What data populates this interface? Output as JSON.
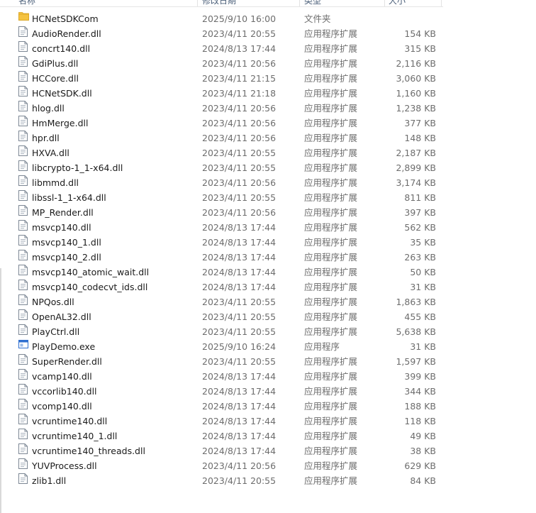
{
  "header": {
    "name": "名称",
    "date": "修改日期",
    "type": "类型",
    "size": "大小"
  },
  "files": [
    {
      "name": "HCNetSDKCom",
      "date": "2025/9/10 16:00",
      "type": "文件夹",
      "size": "",
      "icon": "folder-icon"
    },
    {
      "name": "AudioRender.dll",
      "date": "2023/4/11 20:55",
      "type": "应用程序扩展",
      "size": "154 KB",
      "icon": "dll-file-icon"
    },
    {
      "name": "concrt140.dll",
      "date": "2024/8/13 17:44",
      "type": "应用程序扩展",
      "size": "315 KB",
      "icon": "dll-file-icon"
    },
    {
      "name": "GdiPlus.dll",
      "date": "2023/4/11 20:56",
      "type": "应用程序扩展",
      "size": "2,116 KB",
      "icon": "dll-file-icon"
    },
    {
      "name": "HCCore.dll",
      "date": "2023/4/11 21:15",
      "type": "应用程序扩展",
      "size": "3,060 KB",
      "icon": "dll-file-icon"
    },
    {
      "name": "HCNetSDK.dll",
      "date": "2023/4/11 21:18",
      "type": "应用程序扩展",
      "size": "1,160 KB",
      "icon": "dll-file-icon"
    },
    {
      "name": "hlog.dll",
      "date": "2023/4/11 20:56",
      "type": "应用程序扩展",
      "size": "1,238 KB",
      "icon": "dll-file-icon"
    },
    {
      "name": "HmMerge.dll",
      "date": "2023/4/11 20:56",
      "type": "应用程序扩展",
      "size": "377 KB",
      "icon": "dll-file-icon"
    },
    {
      "name": "hpr.dll",
      "date": "2023/4/11 20:56",
      "type": "应用程序扩展",
      "size": "148 KB",
      "icon": "dll-file-icon"
    },
    {
      "name": "HXVA.dll",
      "date": "2023/4/11 20:55",
      "type": "应用程序扩展",
      "size": "2,187 KB",
      "icon": "dll-file-icon"
    },
    {
      "name": "libcrypto-1_1-x64.dll",
      "date": "2023/4/11 20:55",
      "type": "应用程序扩展",
      "size": "2,899 KB",
      "icon": "dll-file-icon"
    },
    {
      "name": "libmmd.dll",
      "date": "2023/4/11 20:56",
      "type": "应用程序扩展",
      "size": "3,174 KB",
      "icon": "dll-file-icon"
    },
    {
      "name": "libssl-1_1-x64.dll",
      "date": "2023/4/11 20:55",
      "type": "应用程序扩展",
      "size": "811 KB",
      "icon": "dll-file-icon"
    },
    {
      "name": "MP_Render.dll",
      "date": "2023/4/11 20:56",
      "type": "应用程序扩展",
      "size": "397 KB",
      "icon": "dll-file-icon"
    },
    {
      "name": "msvcp140.dll",
      "date": "2024/8/13 17:44",
      "type": "应用程序扩展",
      "size": "562 KB",
      "icon": "dll-file-icon"
    },
    {
      "name": "msvcp140_1.dll",
      "date": "2024/8/13 17:44",
      "type": "应用程序扩展",
      "size": "35 KB",
      "icon": "dll-file-icon"
    },
    {
      "name": "msvcp140_2.dll",
      "date": "2024/8/13 17:44",
      "type": "应用程序扩展",
      "size": "263 KB",
      "icon": "dll-file-icon"
    },
    {
      "name": "msvcp140_atomic_wait.dll",
      "date": "2024/8/13 17:44",
      "type": "应用程序扩展",
      "size": "50 KB",
      "icon": "dll-file-icon"
    },
    {
      "name": "msvcp140_codecvt_ids.dll",
      "date": "2024/8/13 17:44",
      "type": "应用程序扩展",
      "size": "31 KB",
      "icon": "dll-file-icon"
    },
    {
      "name": "NPQos.dll",
      "date": "2023/4/11 20:55",
      "type": "应用程序扩展",
      "size": "1,863 KB",
      "icon": "dll-file-icon"
    },
    {
      "name": "OpenAL32.dll",
      "date": "2023/4/11 20:55",
      "type": "应用程序扩展",
      "size": "455 KB",
      "icon": "dll-file-icon"
    },
    {
      "name": "PlayCtrl.dll",
      "date": "2023/4/11 20:55",
      "type": "应用程序扩展",
      "size": "5,638 KB",
      "icon": "dll-file-icon"
    },
    {
      "name": "PlayDemo.exe",
      "date": "2025/9/10 16:24",
      "type": "应用程序",
      "size": "31 KB",
      "icon": "exe-file-icon"
    },
    {
      "name": "SuperRender.dll",
      "date": "2023/4/11 20:55",
      "type": "应用程序扩展",
      "size": "1,597 KB",
      "icon": "dll-file-icon"
    },
    {
      "name": "vcamp140.dll",
      "date": "2024/8/13 17:44",
      "type": "应用程序扩展",
      "size": "399 KB",
      "icon": "dll-file-icon"
    },
    {
      "name": "vccorlib140.dll",
      "date": "2024/8/13 17:44",
      "type": "应用程序扩展",
      "size": "344 KB",
      "icon": "dll-file-icon"
    },
    {
      "name": "vcomp140.dll",
      "date": "2024/8/13 17:44",
      "type": "应用程序扩展",
      "size": "188 KB",
      "icon": "dll-file-icon"
    },
    {
      "name": "vcruntime140.dll",
      "date": "2024/8/13 17:44",
      "type": "应用程序扩展",
      "size": "118 KB",
      "icon": "dll-file-icon"
    },
    {
      "name": "vcruntime140_1.dll",
      "date": "2024/8/13 17:44",
      "type": "应用程序扩展",
      "size": "49 KB",
      "icon": "dll-file-icon"
    },
    {
      "name": "vcruntime140_threads.dll",
      "date": "2024/8/13 17:44",
      "type": "应用程序扩展",
      "size": "38 KB",
      "icon": "dll-file-icon"
    },
    {
      "name": "YUVProcess.dll",
      "date": "2023/4/11 20:56",
      "type": "应用程序扩展",
      "size": "629 KB",
      "icon": "dll-file-icon"
    },
    {
      "name": "zlib1.dll",
      "date": "2023/4/11 20:55",
      "type": "应用程序扩展",
      "size": "84 KB",
      "icon": "dll-file-icon"
    }
  ],
  "colors": {
    "folder": "#f5c341",
    "dll_icon_border": "#7c8794",
    "exe_icon_accent": "#2f6fd0",
    "text": "#1a1a1a",
    "secondary_text": "#6d6d6d"
  }
}
